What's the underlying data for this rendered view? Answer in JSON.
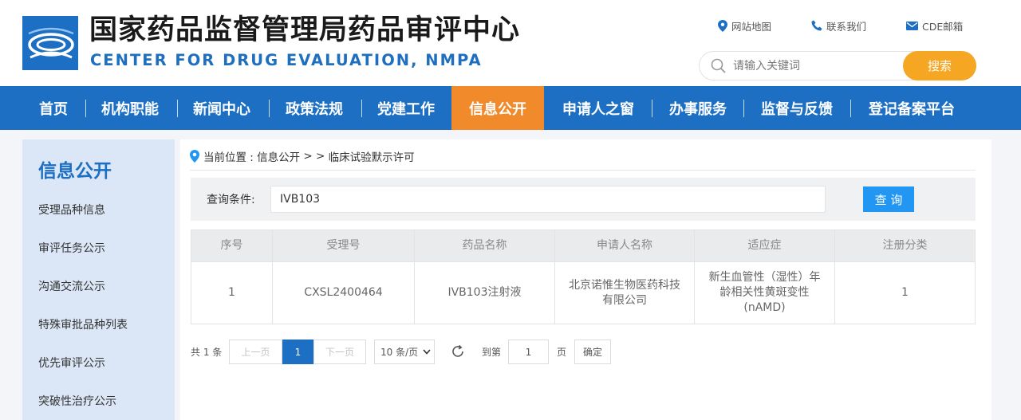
{
  "header": {
    "title_cn": "国家药品监督管理局药品审评中心",
    "title_en": "CENTER FOR DRUG EVALUATION, NMPA",
    "links": {
      "sitemap": "网站地图",
      "contact": "联系我们",
      "mail": "CDE邮箱"
    },
    "search": {
      "placeholder": "请输入关键词",
      "button": "搜索"
    }
  },
  "nav": {
    "items": [
      "首页",
      "机构职能",
      "新闻中心",
      "政策法规",
      "党建工作",
      "信息公开",
      "申请人之窗",
      "办事服务",
      "监督与反馈",
      "登记备案平台"
    ],
    "active": "信息公开"
  },
  "sidebar": {
    "title": "信息公开",
    "items": [
      "受理品种信息",
      "审评任务公示",
      "沟通交流公示",
      "特殊审批品种列表",
      "优先审评公示",
      "突破性治疗公示"
    ]
  },
  "breadcrumb": {
    "prefix": "当前位置 : ",
    "section": "信息公开",
    "sep": " > > ",
    "page": "临床试验默示许可"
  },
  "query": {
    "label": "查询条件:",
    "value": "IVB103",
    "button": "查 询"
  },
  "table": {
    "headers": [
      "序号",
      "受理号",
      "药品名称",
      "申请人名称",
      "适应症",
      "注册分类"
    ],
    "rows": [
      [
        "1",
        "CXSL2400464",
        "IVB103注射液",
        "北京诺惟生物医药科技有限公司",
        "新生血管性（湿性）年龄相关性黄斑变性(nAMD)",
        "1"
      ]
    ]
  },
  "pager": {
    "total": "共 1 条",
    "prev": "上一页",
    "current": "1",
    "next": "下一页",
    "page_size": "10 条/页",
    "goto_label": "到第",
    "goto_value": "1",
    "page_unit": "页",
    "confirm": "确定"
  },
  "colors": {
    "brand_blue": "#1c6fc3",
    "active_orange": "#f08a2a",
    "search_orange": "#f5a623",
    "query_blue": "#2196f3"
  }
}
